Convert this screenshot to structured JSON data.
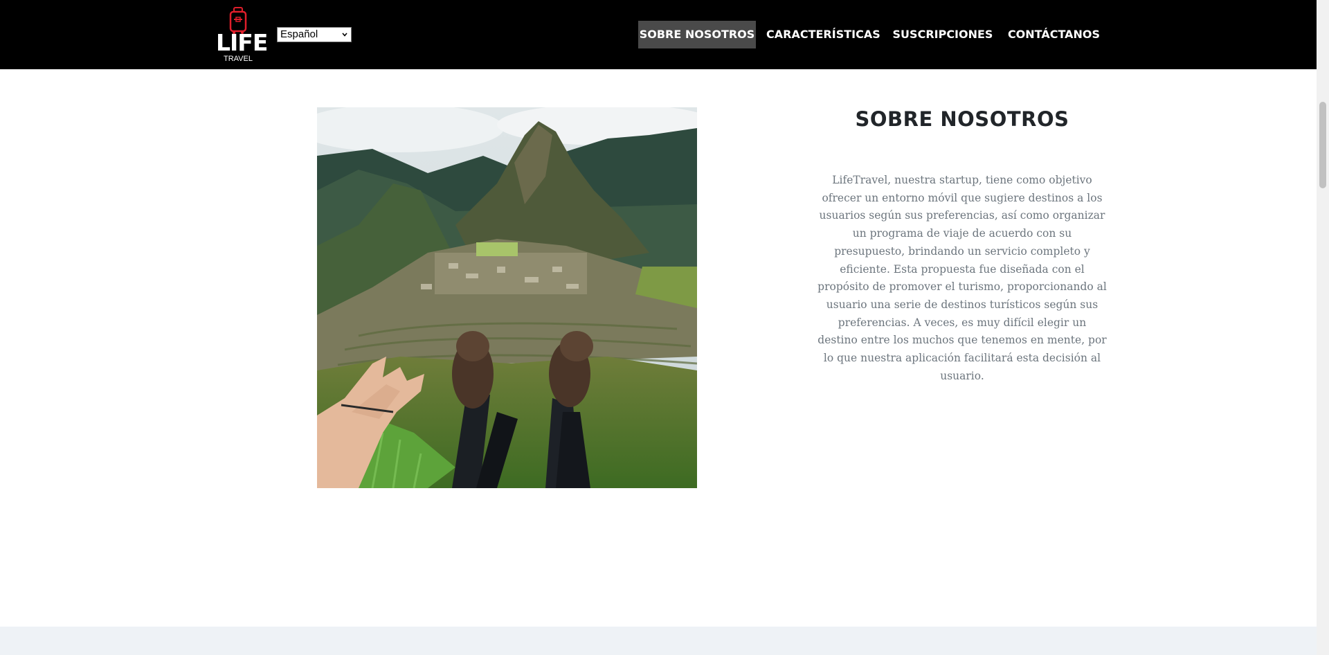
{
  "brand": {
    "name": "LIFE",
    "subtitle": "TRAVEL",
    "bag_color": "#e01e2b"
  },
  "language_select": {
    "value": "Español"
  },
  "nav": {
    "items": [
      {
        "label": "SOBRE NOSOTROS",
        "active": true
      },
      {
        "label": "CARACTERÍSTICAS",
        "active": false
      },
      {
        "label": "SUSCRIPCIONES",
        "active": false
      },
      {
        "label": "CONTÁCTANOS",
        "active": false
      }
    ]
  },
  "about": {
    "image_icon": "machu-picchu-photo",
    "title": "SOBRE NOSOTROS",
    "text": "LifeTravel, nuestra startup, tiene como objetivo ofrecer un entorno móvil que sugiere destinos a los usuarios según sus preferencias, así como organizar un programa de viaje de acuerdo con su presupuesto, brindando un servicio completo y eficiente. Esta propuesta fue diseñada con el propósito de promover el turismo, proporcionando al usuario una serie de destinos turísticos según sus preferencias. A veces, es muy difícil elegir un destino entre los muchos que tenemos en mente, por lo que nuestra aplicación facilitará esta decisión al usuario."
  },
  "colors": {
    "navbar": "#000000",
    "active_nav": "#4a4a4a",
    "title": "#212529",
    "body_text": "#6c757d",
    "footer_band": "#eef2f6"
  }
}
